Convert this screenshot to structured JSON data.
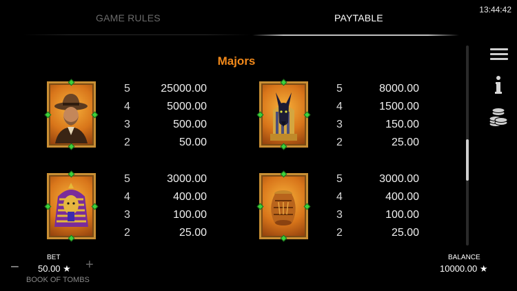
{
  "clock": "13:44:42",
  "tabs": [
    {
      "label": "GAME RULES",
      "active": false
    },
    {
      "label": "PAYTABLE",
      "active": true
    }
  ],
  "section_title": "Majors",
  "symbols": [
    {
      "name": "explorer-symbol-icon",
      "pays": [
        {
          "count": "5",
          "amount": "25000.00"
        },
        {
          "count": "4",
          "amount": "5000.00"
        },
        {
          "count": "3",
          "amount": "500.00"
        },
        {
          "count": "2",
          "amount": "50.00"
        }
      ]
    },
    {
      "name": "anubis-symbol-icon",
      "pays": [
        {
          "count": "5",
          "amount": "8000.00"
        },
        {
          "count": "4",
          "amount": "1500.00"
        },
        {
          "count": "3",
          "amount": "150.00"
        },
        {
          "count": "2",
          "amount": "25.00"
        }
      ]
    },
    {
      "name": "pharaoh-symbol-icon",
      "pays": [
        {
          "count": "5",
          "amount": "3000.00"
        },
        {
          "count": "4",
          "amount": "400.00"
        },
        {
          "count": "3",
          "amount": "100.00"
        },
        {
          "count": "2",
          "amount": "25.00"
        }
      ]
    },
    {
      "name": "urn-symbol-icon",
      "pays": [
        {
          "count": "5",
          "amount": "3000.00"
        },
        {
          "count": "4",
          "amount": "400.00"
        },
        {
          "count": "3",
          "amount": "100.00"
        },
        {
          "count": "2",
          "amount": "25.00"
        }
      ]
    }
  ],
  "bet": {
    "label": "BET",
    "value": "50.00 ★",
    "minus": "−",
    "plus": "+"
  },
  "game_name": "BOOK OF TOMBS",
  "balance": {
    "label": "BALANCE",
    "value": "10000.00 ★"
  },
  "colors": {
    "accent": "#f2891a",
    "frame": "#c98f34",
    "gem": "#3cd23c"
  }
}
